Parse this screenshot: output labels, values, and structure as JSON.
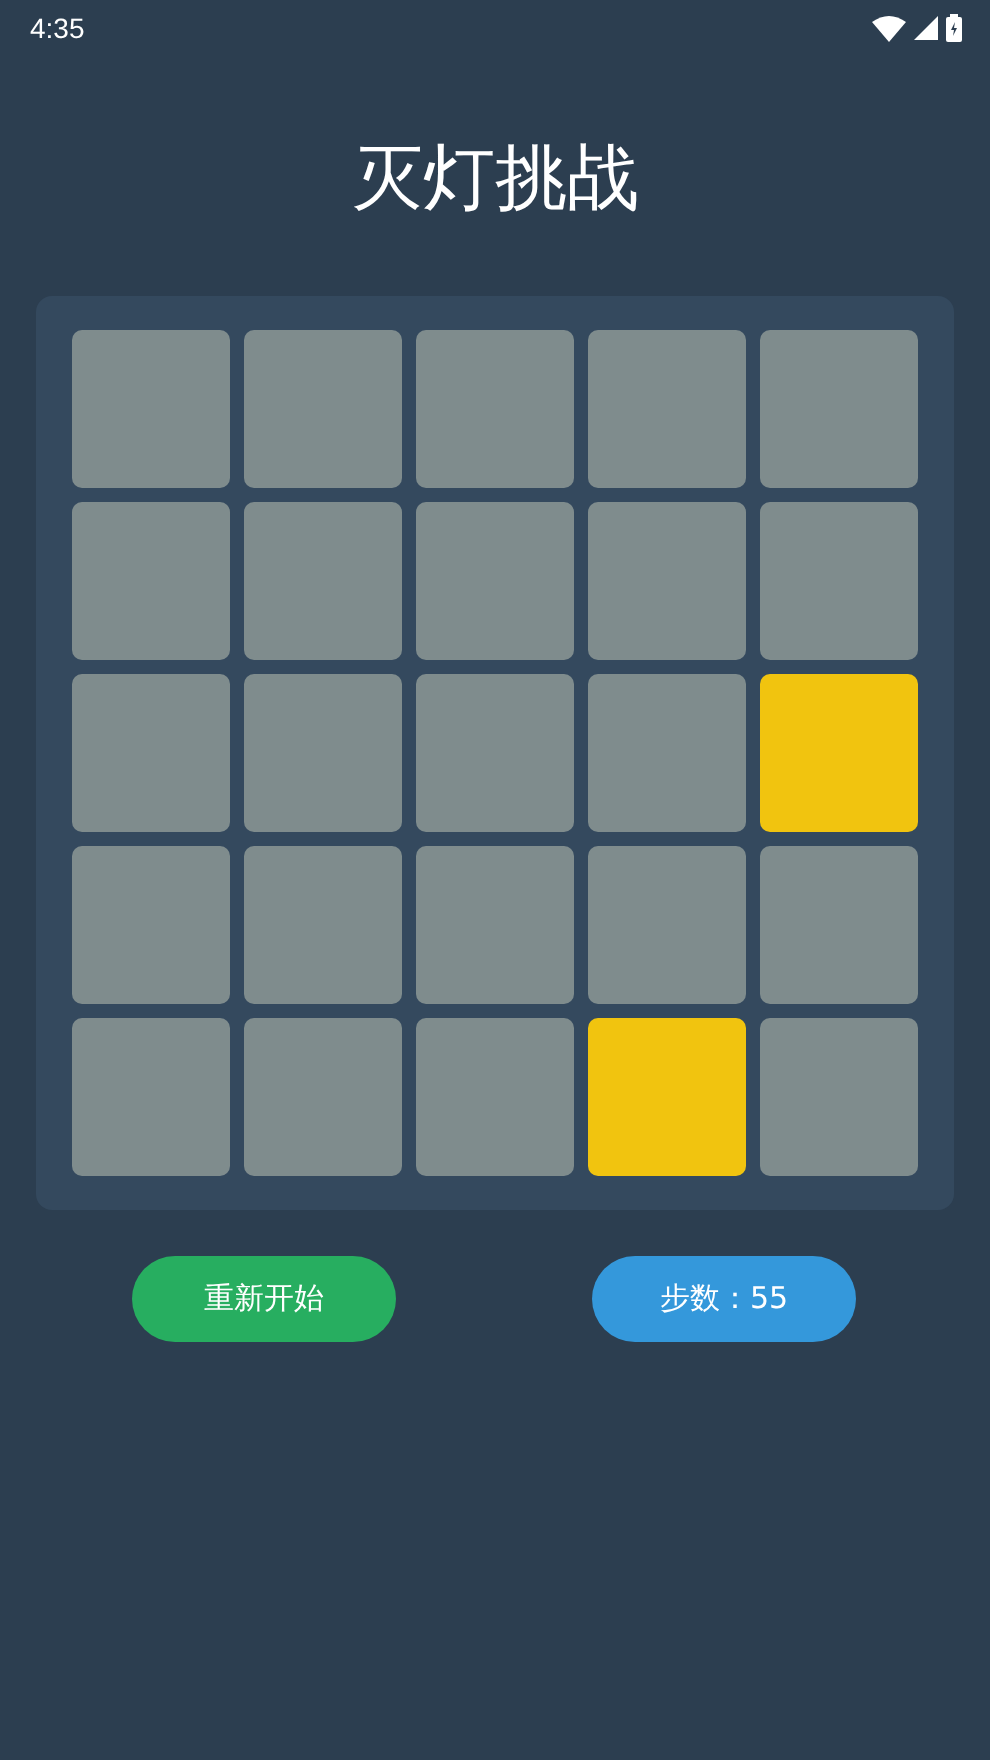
{
  "status_bar": {
    "time": "4:35"
  },
  "title": "灭灯挑战",
  "board": {
    "rows": [
      [
        {
          "lit": false
        },
        {
          "lit": false
        },
        {
          "lit": false
        },
        {
          "lit": false
        },
        {
          "lit": false
        }
      ],
      [
        {
          "lit": false
        },
        {
          "lit": false
        },
        {
          "lit": false
        },
        {
          "lit": false
        },
        {
          "lit": false
        }
      ],
      [
        {
          "lit": false
        },
        {
          "lit": false
        },
        {
          "lit": false
        },
        {
          "lit": false
        },
        {
          "lit": true
        }
      ],
      [
        {
          "lit": false
        },
        {
          "lit": false
        },
        {
          "lit": false
        },
        {
          "lit": false
        },
        {
          "lit": false
        }
      ],
      [
        {
          "lit": false
        },
        {
          "lit": false
        },
        {
          "lit": false
        },
        {
          "lit": true
        },
        {
          "lit": false
        }
      ]
    ]
  },
  "buttons": [
    {
      "kind": "restart",
      "label": "重新开始"
    },
    {
      "kind": "steps",
      "label": "步数：55"
    }
  ]
}
